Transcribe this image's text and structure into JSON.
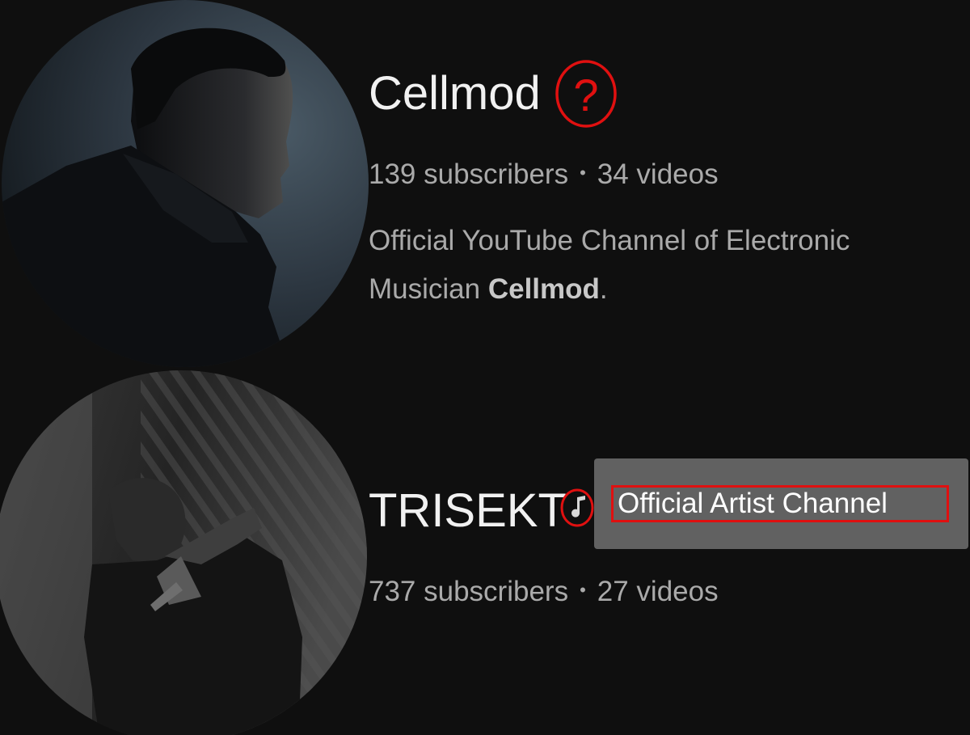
{
  "channels": [
    {
      "name": "Cellmod",
      "subscribers": "139 subscribers",
      "separator": "•",
      "videos": "34 videos",
      "description_prefix": "Official YouTube Channel of Electronic Musician ",
      "description_bold": "Cellmod",
      "description_suffix": "."
    },
    {
      "name": "TRISEKT",
      "subscribers": "737 subscribers",
      "separator": "•",
      "videos": "27 videos"
    }
  ],
  "annotations": {
    "question_mark": "?"
  },
  "tooltip": {
    "text": "Official Artist Channel"
  },
  "icons": {
    "avatar_1": "avatar-photo",
    "question_mark": "question-mark-annotation-icon",
    "music_note": "music-note-icon"
  },
  "colors": {
    "background": "#0f0f0f",
    "annotation_red": "#e01010",
    "tooltip_bg": "#616161",
    "primary_text": "#f1f1f1",
    "secondary_text": "#aaaaaa"
  }
}
